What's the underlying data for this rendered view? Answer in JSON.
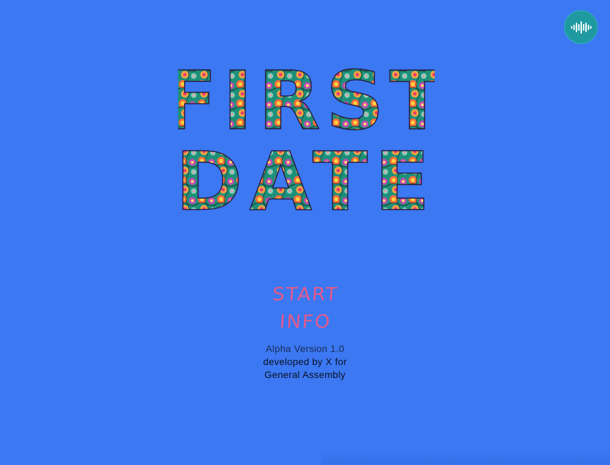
{
  "header": {
    "audio_icon": "audio-waveform-icon"
  },
  "title": {
    "line1": "FIRST",
    "line2": "DATE"
  },
  "menu": {
    "start_label": "START",
    "info_label": "INFO"
  },
  "footer": {
    "version": "Alpha Version 1.0",
    "credit_line1": "developed by X for",
    "credit_line2": "General Assembly"
  },
  "colors": {
    "background": "#3b78f2",
    "menu_text": "#e35a8a",
    "audio_button": "#1f9aa0"
  }
}
